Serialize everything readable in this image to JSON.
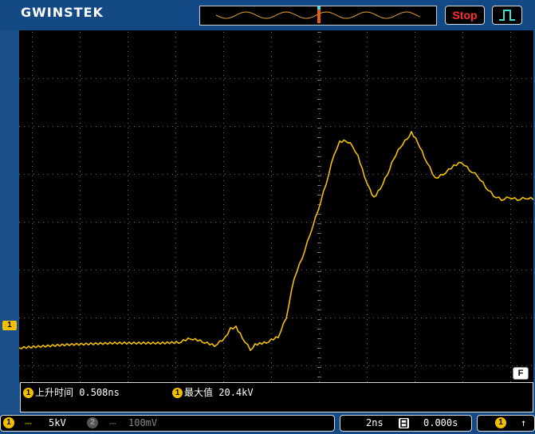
{
  "header": {
    "logo": "GWINSTEK",
    "stop_label": "Stop"
  },
  "screen": {
    "ch1_marker": "1",
    "filter_badge": "F"
  },
  "measurements": [
    {
      "icon": "1",
      "label": "上升时间",
      "value": "0.508ns"
    },
    {
      "icon": "1",
      "label": "最大值",
      "value": "20.4kV"
    }
  ],
  "status": {
    "ch1_icon": "1",
    "ch1_coupling": "DC",
    "ch1_scale": "5kV",
    "ch2_icon": "2",
    "ch2_scale": "100mV",
    "timebase": "2ns",
    "position": "0.000s",
    "trig_icon": "1"
  },
  "colors": {
    "trace": "#f2c000",
    "background": "#1a4f8a",
    "stop": "#ff3030"
  }
}
